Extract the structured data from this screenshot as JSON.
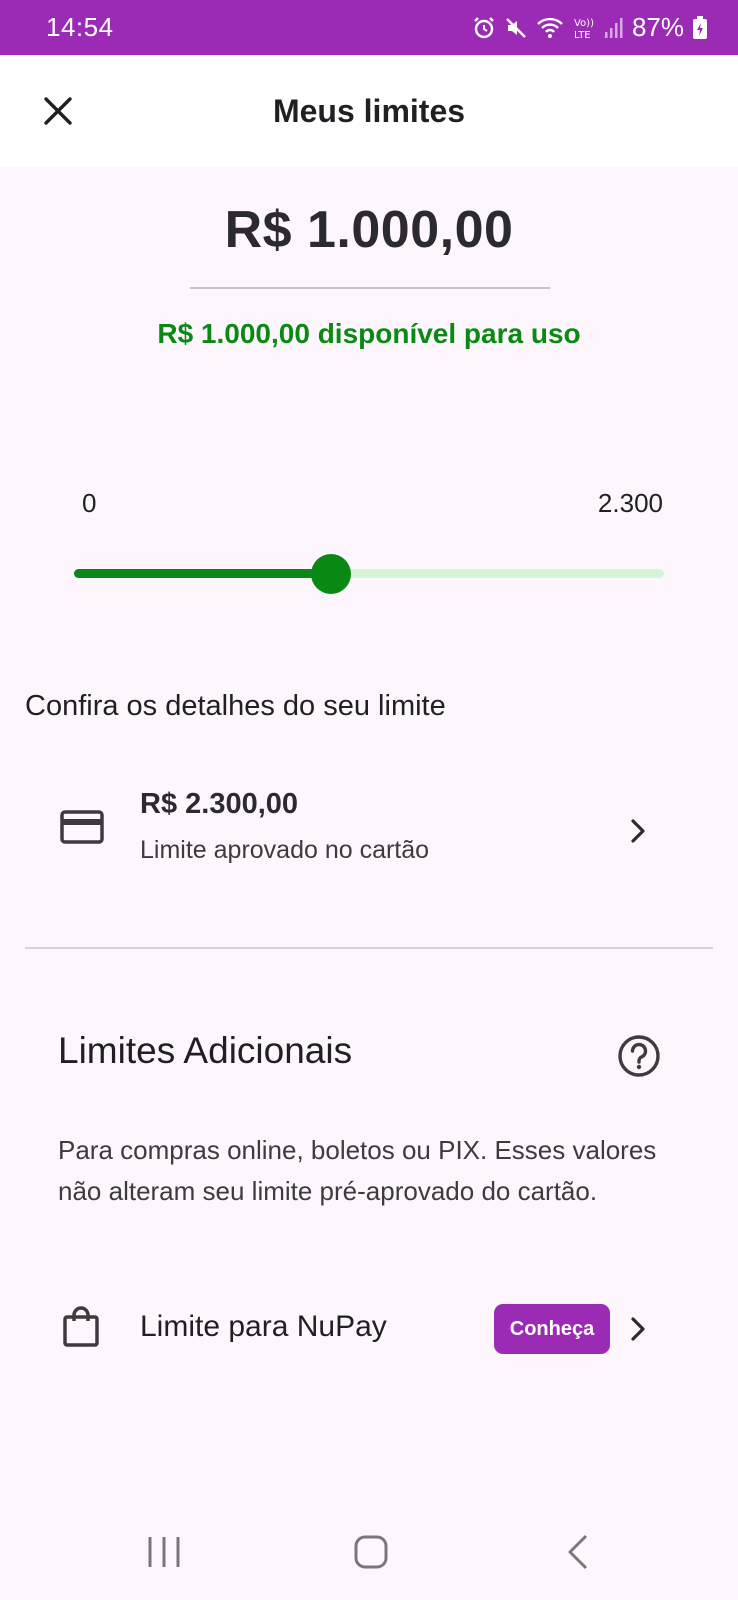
{
  "status_bar": {
    "time": "14:54",
    "battery": "87%",
    "icons": [
      "alarm-icon",
      "mute-icon",
      "wifi-icon",
      "volte-icon",
      "signal-icon",
      "battery-charging-icon"
    ]
  },
  "header": {
    "title": "Meus limites",
    "close_icon": "close-icon"
  },
  "limit": {
    "amount": "R$ 1.000,00",
    "available_text": "R$ 1.000,00 disponível para uso"
  },
  "slider": {
    "min_label": "0",
    "max_label": "2.300",
    "min": 0,
    "max": 2300,
    "value": 1000
  },
  "details": {
    "title": "Confira os detalhes do seu limite",
    "card": {
      "icon": "credit-card-icon",
      "amount": "R$ 2.300,00",
      "label": "Limite aprovado no cartão"
    }
  },
  "additional": {
    "title": "Limites Adicionais",
    "help_icon": "help-icon",
    "description": "Para compras online, boletos ou PIX. Esses valores não alteram seu limite pré-aprovado do cartão.",
    "nupay": {
      "icon": "shopping-bag-icon",
      "label": "Limite para NuPay",
      "badge": "Conheça"
    }
  },
  "colors": {
    "accent_purple": "#9b2bb5",
    "success_green": "#0a8a14",
    "track_light": "#d7f4d7",
    "background": "#fdf7fd"
  },
  "nav_bar": {
    "buttons": [
      "recents-icon",
      "home-icon",
      "back-icon"
    ]
  }
}
